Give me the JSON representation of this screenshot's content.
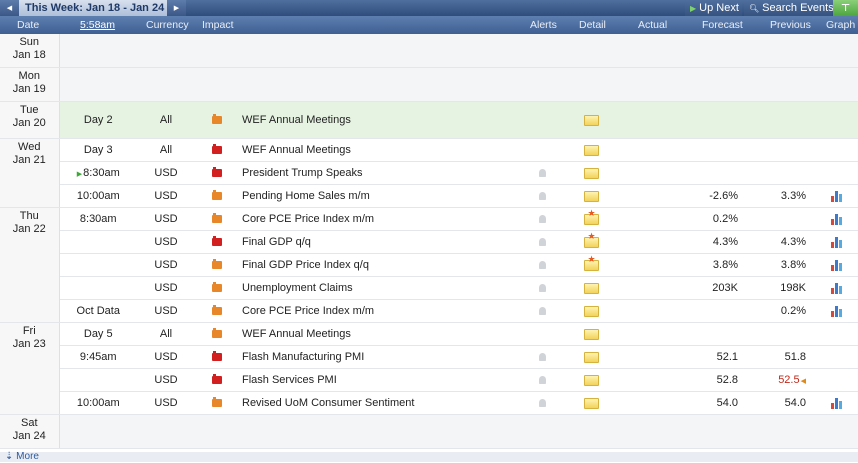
{
  "nav": {
    "week_title": "This Week: Jan 18 - Jan 24",
    "up_next": "Up Next",
    "search_events": "Search Events"
  },
  "columns": {
    "date": "Date",
    "time": "5:58am",
    "currency": "Currency",
    "impact": "Impact",
    "alerts": "Alerts",
    "detail": "Detail",
    "actual": "Actual",
    "forecast": "Forecast",
    "previous": "Previous",
    "graph": "Graph"
  },
  "days": [
    {
      "weekday": "Sun",
      "date": "Jan 18"
    },
    {
      "weekday": "Mon",
      "date": "Jan 19"
    },
    {
      "weekday": "Tue",
      "date": "Jan 20"
    },
    {
      "weekday": "Wed",
      "date": "Jan 21"
    },
    {
      "weekday": "Thu",
      "date": "Jan 22"
    },
    {
      "weekday": "Fri",
      "date": "Jan 23"
    },
    {
      "weekday": "Sat",
      "date": "Jan 24"
    }
  ],
  "events": [
    {
      "time": "Day 2",
      "currency": "All",
      "impact": "medium",
      "event": "WEF Annual Meetings",
      "actual": "",
      "forecast": "",
      "previous": ""
    },
    {
      "time": "Day 3",
      "currency": "All",
      "impact": "high",
      "event": "WEF Annual Meetings",
      "actual": "",
      "forecast": "",
      "previous": ""
    },
    {
      "time": "8:30am",
      "currency": "USD",
      "impact": "high",
      "event": "President Trump Speaks",
      "actual": "",
      "forecast": "",
      "previous": ""
    },
    {
      "time": "10:00am",
      "currency": "USD",
      "impact": "medium",
      "event": "Pending Home Sales m/m",
      "actual": "",
      "forecast": "-2.6%",
      "previous": "3.3%"
    },
    {
      "time": "8:30am",
      "currency": "USD",
      "impact": "medium",
      "event": "Core PCE Price Index m/m",
      "actual": "",
      "forecast": "0.2%",
      "previous": ""
    },
    {
      "time": "",
      "currency": "USD",
      "impact": "high",
      "event": "Final GDP q/q",
      "actual": "",
      "forecast": "4.3%",
      "previous": "4.3%"
    },
    {
      "time": "",
      "currency": "USD",
      "impact": "medium",
      "event": "Final GDP Price Index q/q",
      "actual": "",
      "forecast": "3.8%",
      "previous": "3.8%"
    },
    {
      "time": "",
      "currency": "USD",
      "impact": "medium",
      "event": "Unemployment Claims",
      "actual": "",
      "forecast": "203K",
      "previous": "198K"
    },
    {
      "time": "Oct Data",
      "currency": "USD",
      "impact": "medium",
      "event": "Core PCE Price Index m/m",
      "actual": "",
      "forecast": "",
      "previous": "0.2%"
    },
    {
      "time": "Day 5",
      "currency": "All",
      "impact": "medium",
      "event": "WEF Annual Meetings",
      "actual": "",
      "forecast": "",
      "previous": ""
    },
    {
      "time": "9:45am",
      "currency": "USD",
      "impact": "high",
      "event": "Flash Manufacturing PMI",
      "actual": "",
      "forecast": "52.1",
      "previous": "51.8"
    },
    {
      "time": "",
      "currency": "USD",
      "impact": "high",
      "event": "Flash Services PMI",
      "actual": "",
      "forecast": "52.8",
      "previous": "52.5"
    },
    {
      "time": "10:00am",
      "currency": "USD",
      "impact": "medium",
      "event": "Revised UoM Consumer Sentiment",
      "actual": "",
      "forecast": "54.0",
      "previous": "54.0"
    }
  ],
  "footer": {
    "more": "More"
  },
  "colors": {
    "impact_high": "#d22020",
    "impact_medium": "#e8862a",
    "revised_value": "#c02a1a",
    "header": "#3f5f92"
  }
}
